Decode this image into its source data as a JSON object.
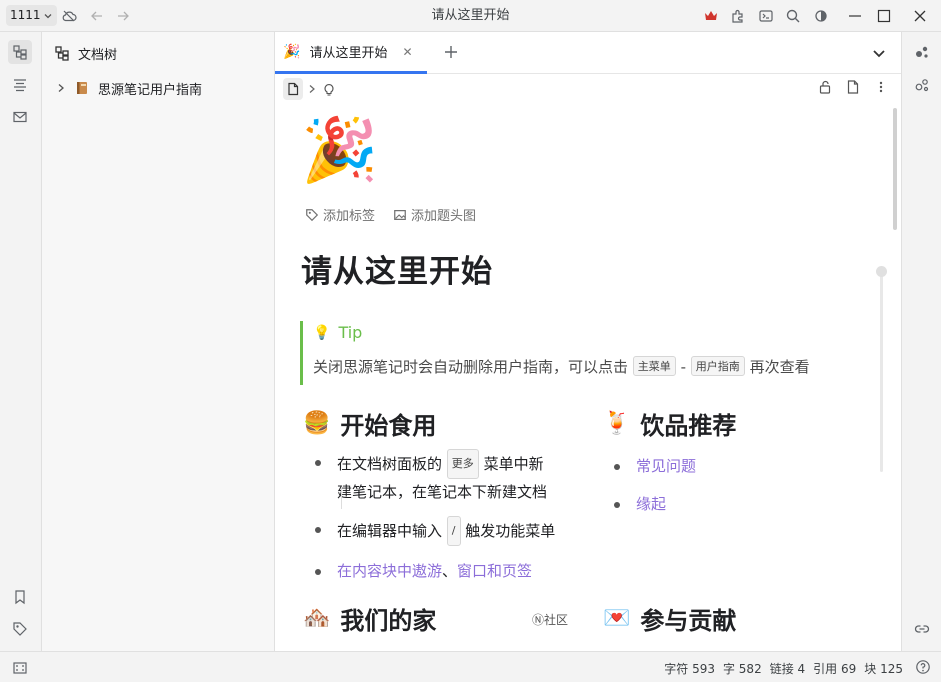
{
  "window": {
    "workspace": "1111",
    "title": "请从这里开始"
  },
  "filetree": {
    "header": "文档树",
    "items": [
      {
        "label": "思源笔记用户指南",
        "icon": "notebook-icon"
      }
    ]
  },
  "tabs": [
    {
      "label": "请从这里开始",
      "icon": "party-popper-icon"
    }
  ],
  "document": {
    "icon_emoji": "🎉",
    "add_tag": "添加标签",
    "add_cover": "添加题头图",
    "title": "请从这里开始",
    "tip": {
      "label": "Tip",
      "text_before": "关闭思源笔记时会自动删除用户指南，可以点击",
      "kbd1": "主菜单",
      "dash": "-",
      "kbd2": "用户指南",
      "text_after": "再次查看"
    },
    "sections": {
      "start": {
        "emoji": "🍔",
        "title": "开始食用",
        "item1_a": "在文档树面板的",
        "item1_kbd": "更多",
        "item1_b": "菜单中新",
        "item1_c": "建笔记本，在笔记本下新建文档",
        "item2_a": "在编辑器中输入",
        "item2_kbd": "/",
        "item2_b": "触发功能菜单",
        "item3_link1": "在内容块中遨游",
        "item3_sep": "、",
        "item3_link2": "窗口和页签"
      },
      "drinks": {
        "emoji": "🍹",
        "title": "饮品推荐",
        "items": [
          "常见问题",
          "缘起"
        ]
      },
      "home": {
        "emoji": "🏘️",
        "title": "我们的家"
      },
      "contrib": {
        "emoji": "💌",
        "title": "参与贡献"
      }
    },
    "community_label": "Ⓝ社区"
  },
  "status": {
    "chars": "字符 593",
    "words": "字 582",
    "links": "链接 4",
    "refs": "引用 69",
    "blocks": "块 125"
  },
  "colors": {
    "accent": "#3575f0",
    "tip_green": "#6abe4a",
    "link_purple": "#8c6ed9",
    "titlebar_crown": "#d0342c"
  }
}
